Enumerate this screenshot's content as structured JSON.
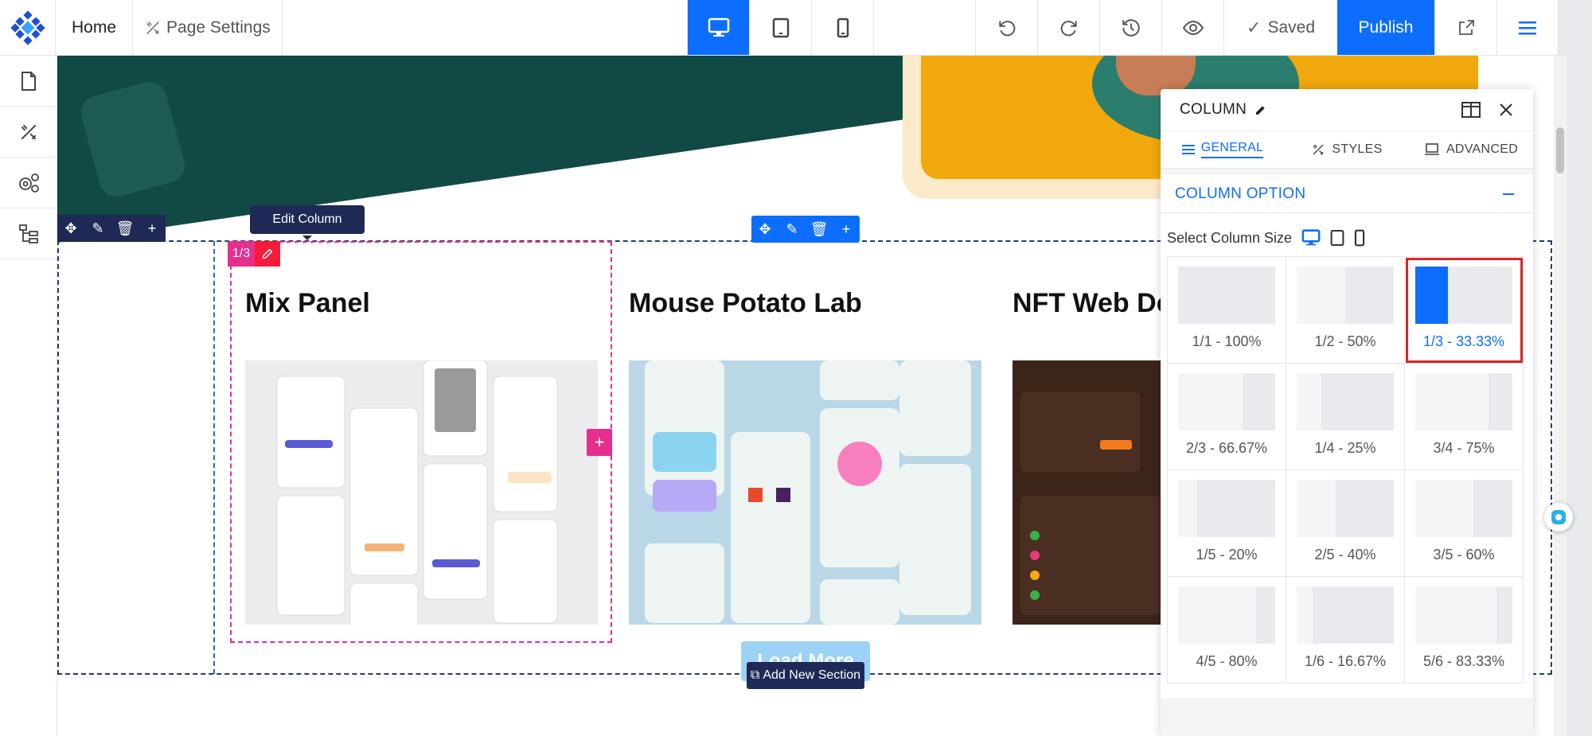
{
  "toolbar": {
    "home_label": "Home",
    "page_settings_label": "Page Settings",
    "saved_label": "Saved",
    "publish_label": "Publish"
  },
  "canvas": {
    "edit_column_tooltip": "Edit Column",
    "column_badge": "1/3",
    "cards": [
      {
        "title": "Mix Panel"
      },
      {
        "title": "Mouse Potato Lab"
      },
      {
        "title": "NFT Web De"
      }
    ],
    "load_more_label": "Load More",
    "add_section_label": "Add New Section"
  },
  "panel": {
    "title": "COLUMN",
    "tabs": [
      {
        "label": "GENERAL",
        "active": true
      },
      {
        "label": "STYLES",
        "active": false
      },
      {
        "label": "ADVANCED",
        "active": false
      }
    ],
    "section_title": "COLUMN OPTION",
    "select_size_label": "Select Column Size",
    "sizes": [
      {
        "label": "1/1 - 100%",
        "fraction": 1.0
      },
      {
        "label": "1/2 - 50%",
        "fraction": 0.5
      },
      {
        "label": "1/3 - 33.33%",
        "fraction": 0.3333,
        "selected": true
      },
      {
        "label": "2/3 - 66.67%",
        "fraction": 0.6667
      },
      {
        "label": "1/4 - 25%",
        "fraction": 0.25
      },
      {
        "label": "3/4 - 75%",
        "fraction": 0.75
      },
      {
        "label": "1/5 - 20%",
        "fraction": 0.2
      },
      {
        "label": "2/5 - 40%",
        "fraction": 0.4
      },
      {
        "label": "3/5 - 60%",
        "fraction": 0.6
      },
      {
        "label": "4/5 - 80%",
        "fraction": 0.8
      },
      {
        "label": "1/6 - 16.67%",
        "fraction": 0.1667
      },
      {
        "label": "5/6 - 83.33%",
        "fraction": 0.8333
      }
    ]
  },
  "colors": {
    "accent": "#0d6efd",
    "column_pink": "#e62e8c",
    "selected_outline": "#e02424",
    "hero_green": "#114a44",
    "hero_yellow": "#f1a80c"
  }
}
